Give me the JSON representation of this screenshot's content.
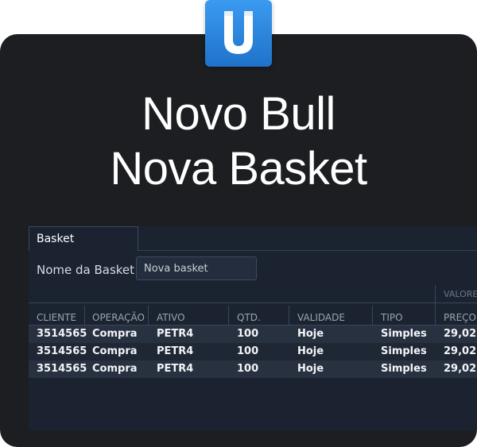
{
  "brand": {
    "logo_icon": "u-logo-icon",
    "logo_color": "#2b88e0"
  },
  "headline": {
    "line1": "Novo Bull",
    "line2": "Nova Basket"
  },
  "tab": {
    "label": "Basket"
  },
  "form": {
    "name_label": "Nome da Basket",
    "name_value": "Nova basket"
  },
  "table": {
    "group_header": "VALORES",
    "columns": [
      "CLIENTE",
      "OPERAÇÃO",
      "ATIVO",
      "QTD.",
      "VALIDADE",
      "TIPO",
      "PREÇO"
    ],
    "rows": [
      [
        "3514565",
        "Compra",
        "PETR4",
        "100",
        "Hoje",
        "Simples",
        "29,02"
      ],
      [
        "3514565",
        "Compra",
        "PETR4",
        "100",
        "Hoje",
        "Simples",
        "29,02"
      ],
      [
        "3514565",
        "Compra",
        "PETR4",
        "100",
        "Hoje",
        "Simples",
        "29,02"
      ]
    ]
  }
}
